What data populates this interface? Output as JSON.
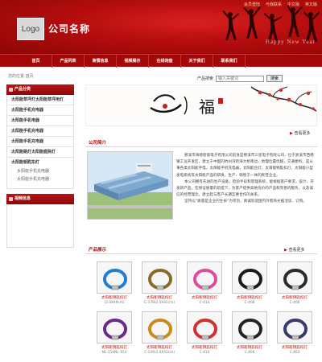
{
  "header": {
    "top_links": [
      "会员登陆",
      "与我联系",
      "中文版",
      "英文版"
    ],
    "logo_text": "Logo",
    "company_name": "公司名称",
    "decor_text": "Happy New Year"
  },
  "nav": {
    "items": [
      "首页",
      "产品列表",
      "商情信息",
      "视频展示",
      "在线询盘",
      "关于我们",
      "联系我们"
    ]
  },
  "breadcrumb": "您的位置 首页",
  "search": {
    "label": "产品搜索",
    "placeholder": "输入关键词",
    "button": "搜索"
  },
  "sidebar": {
    "products_title": "产品分类",
    "categories": [
      {
        "name": "太阳能草坪灯太阳能草坪用灯",
        "subs": []
      },
      {
        "name": "太阳能手机充电器",
        "subs": []
      },
      {
        "name": "太阳能手机电器",
        "subs": []
      },
      {
        "name": "太阳能手机充电器",
        "subs": []
      },
      {
        "name": "太阳能手机充电器",
        "subs": []
      },
      {
        "name": "太阳能路灯太阳能庭院灯",
        "subs": []
      },
      {
        "name": "太阳能钥匙扣灯",
        "subs": [
          "太阳能手机充电器",
          "太阳能手机充电器"
        ]
      }
    ],
    "video_title": "视频信息"
  },
  "banner": {
    "big_char": "福"
  },
  "more_label": "查看更多",
  "intro": {
    "title": "公司简介",
    "paragraphs": [
      "慈溪市海绩智能电子有限公司前身是慈溪市三星电子有限公司，位于浙溪市西杨镇工业开发区，建立于中国的杭州湾跨海大桥南边，地理位置优越，交通便利。是从事各类太阳能手电，太阳能手机充电器，太阳能台灯，太阳能钥匙扣灯，太阳能小型发电系统等太阳能产品的研发、生产、销售于一体的民营企业。",
      "本公司拥有先进的生产设备，检验手段和管理系统，能根据客户要求，设计、开发新产品，在保证质量的前提下，为客户提供高质优价的产品和完善的服务，以及诚信的经营理念，建立起与客户长期互惠合作的关系。",
      "坚持以“质量是企业的生命”为宗旨，真诚欢迎国内外客商光临洽谈、订购。"
    ]
  },
  "products": {
    "title": "产品展示",
    "items": [
      {
        "name": "太阳能钥匙扣灯",
        "code": "(2.0X49cm)",
        "color": "#1f7ed6"
      },
      {
        "name": "太阳能钥匙扣灯",
        "code": "C-178(2.5X41cm)",
        "color": "#8a6a2a"
      },
      {
        "name": "太阳能钥匙扣灯",
        "code": "C-414",
        "color": "#e04aa0"
      },
      {
        "name": "太阳能钥匙扣灯",
        "code": "C-408",
        "color": "#1a1a1a"
      },
      {
        "name": "太阳能钥匙扣灯",
        "code": "C-400",
        "color": "#2a2a2a"
      },
      {
        "name": "太阳能钥匙扣灯",
        "code": "NL-154NL-154",
        "color": "#6a2a8a"
      },
      {
        "name": "太阳能钥匙扣灯",
        "code": "C-149(2.0X41cm)",
        "color": "#c98a1a"
      },
      {
        "name": "太阳能钥匙扣灯",
        "code": "C-414",
        "color": "#d13030"
      },
      {
        "name": "太阳能钥匙扣灯",
        "code": "C-406",
        "color": "#222222"
      },
      {
        "name": "太阳能钥匙扣灯",
        "code": "C-402",
        "color": "#3a3a6a"
      }
    ]
  },
  "colors": {
    "brand_red": "#b40d0d",
    "nav_red": "#a30808",
    "title_red": "#b80e0e"
  }
}
